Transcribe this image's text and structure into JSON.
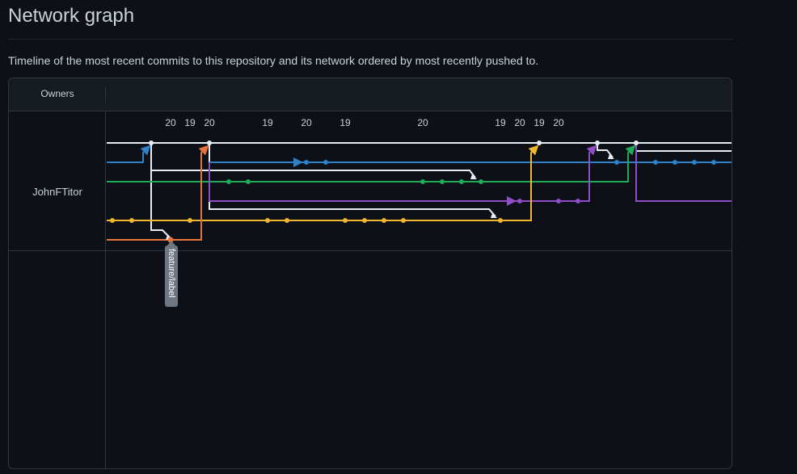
{
  "page": {
    "title": "Network graph",
    "description": "Timeline of the most recent commits to this repository and its network ordered by most recently pushed to."
  },
  "graph": {
    "owners_header": "Owners",
    "owner": "JohnFTitor",
    "dates": [
      "20",
      "19",
      "20",
      "19",
      "20",
      "19",
      "20",
      "19",
      "20",
      "19",
      "20"
    ],
    "branch_tag": "feature/label",
    "colors": {
      "white": "#e6edf3",
      "blue": "#2f81c7",
      "green": "#1faa59",
      "purple": "#8e4ec6",
      "yellow": "#f2b630",
      "orange": "#e8733a"
    }
  }
}
